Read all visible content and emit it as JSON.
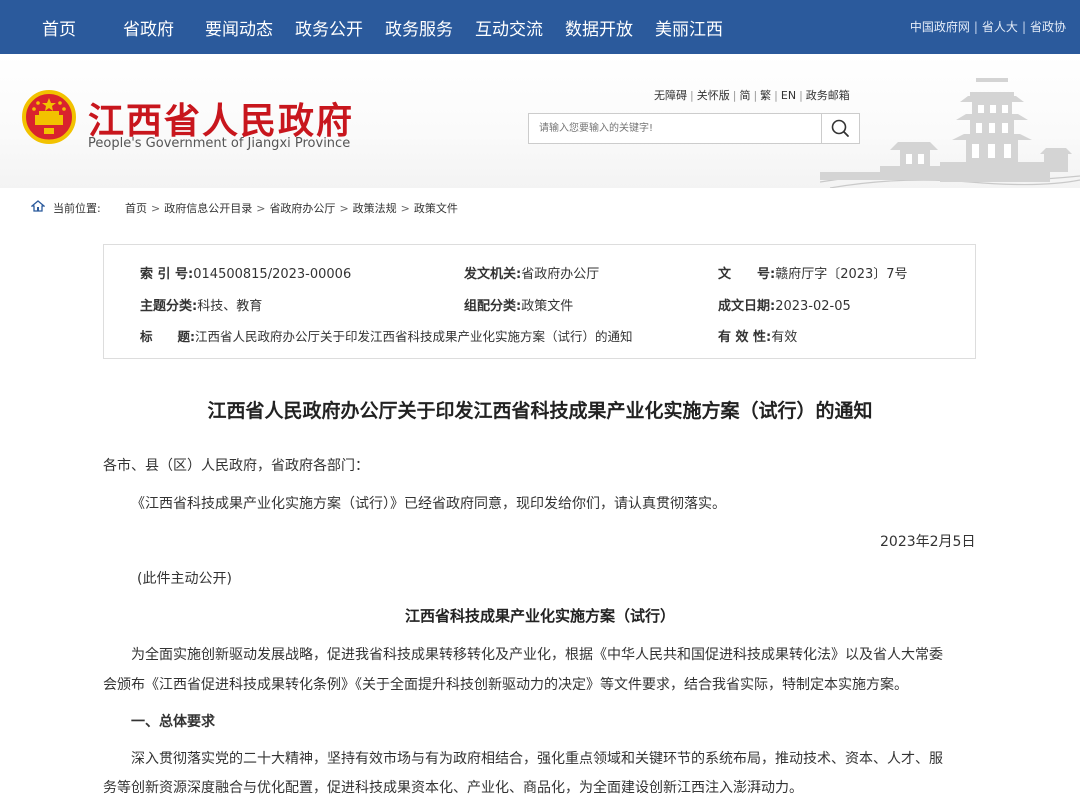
{
  "nav": {
    "items": [
      "首页",
      "省政府",
      "要闻动态",
      "政务公开",
      "政务服务",
      "互动交流",
      "数据开放",
      "美丽江西"
    ],
    "links": [
      "中国政府网",
      "省人大",
      "省政协"
    ]
  },
  "header": {
    "title": "江西省人民政府",
    "subtitle": "People's Government of Jiangxi Province",
    "util_links": [
      "无障碍",
      "关怀版",
      "简",
      "繁",
      "EN",
      "政务邮箱"
    ],
    "search_placeholder": "请输入您要输入的关键字!"
  },
  "breadcrumb": {
    "label": "当前位置:",
    "items": [
      "首页",
      "政府信息公开目录",
      "省政府办公厅",
      "政策法规",
      "政策文件"
    ]
  },
  "meta": {
    "index_label": "索 引 号:",
    "index_value": "014500815/2023-00006",
    "issuer_label": "发文机关:",
    "issuer_value": "省政府办公厅",
    "docno_label": "文　　号:",
    "docno_value": "赣府厅字〔2023〕7号",
    "topic_label": "主题分类:",
    "topic_value": "科技、教育",
    "category_label": "组配分类:",
    "category_value": "政策文件",
    "date_label": "成文日期:",
    "date_value": "2023-02-05",
    "title_label": "标　　题:",
    "title_value": "江西省人民政府办公厅关于印发江西省科技成果产业化实施方案（试行）的通知",
    "valid_label": "有 效 性:",
    "valid_value": "有效"
  },
  "article": {
    "title": "江西省人民政府办公厅关于印发江西省科技成果产业化实施方案（试行）的通知",
    "salutation": "各市、县（区）人民政府，省政府各部门：",
    "para1": "《江西省科技成果产业化实施方案（试行）》已经省政府同意，现印发给你们，请认真贯彻落实。",
    "date": "2023年2月5日",
    "note": "(此件主动公开)",
    "subtitle": "江西省科技成果产业化实施方案（试行）",
    "para2_line1": "为全面实施创新驱动发展战略，促进我省科技成果转移转化及产业化，根据《中华人民共和国促进科技成果转化法》以及省人大常委",
    "para2_line2": "会颁布《江西省促进科技成果转化条例》《关于全面提升科技创新驱动力的决定》等文件要求，结合我省实际，特制定本实施方案。",
    "section1": "一、总体要求",
    "para3_line1": "深入贯彻落实党的二十大精神，坚持有效市场与有为政府相结合，强化重点领域和关键环节的系统布局，推动技术、资本、人才、服",
    "para3_line2": "务等创新资源深度融合与优化配置，促进科技成果资本化、产业化、商品化，为全面建设创新江西注入澎湃动力。"
  },
  "colors": {
    "nav_bg": "#2b5a9c",
    "title_red": "#c8161d"
  }
}
